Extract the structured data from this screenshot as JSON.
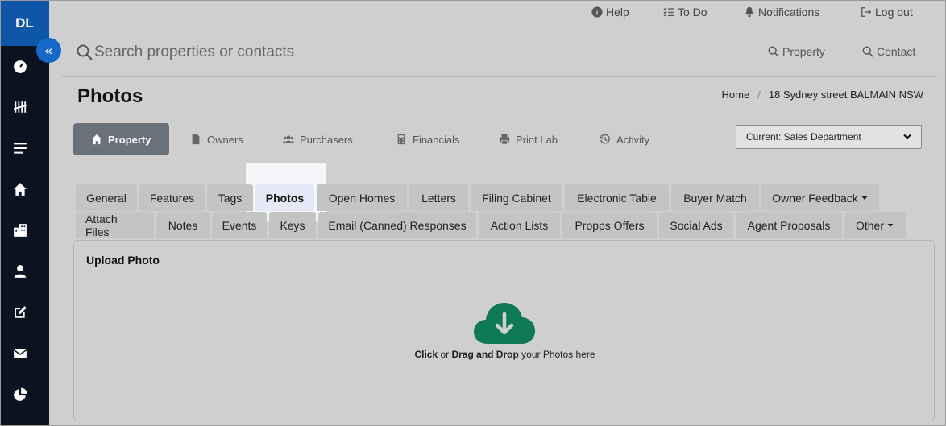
{
  "sidebar": {
    "logo": "DL",
    "collapse_icon": "double-chevron-left-icon",
    "items": [
      {
        "icon": "dashboard-icon"
      },
      {
        "icon": "tally-icon"
      },
      {
        "icon": "list-icon"
      },
      {
        "icon": "home-icon"
      },
      {
        "icon": "building-icon"
      },
      {
        "icon": "user-icon"
      },
      {
        "icon": "edit-icon"
      },
      {
        "icon": "mail-icon"
      },
      {
        "icon": "pie-chart-icon"
      }
    ]
  },
  "topbar": {
    "help": "Help",
    "todo": "To Do",
    "notifications": "Notifications",
    "logout": "Log out"
  },
  "search": {
    "placeholder": "Search properties or contacts",
    "property_label": "Property",
    "contact_label": "Contact"
  },
  "page": {
    "title": "Photos",
    "breadcrumb": [
      "Home",
      "18 Sydney street BALMAIN NSW"
    ]
  },
  "module_tabs": [
    "Property",
    "Owners",
    "Purchasers",
    "Financials",
    "Print Lab",
    "Activity"
  ],
  "department": "Current: Sales Department",
  "subtabs_row1": [
    "General",
    "Features",
    "Tags",
    "Photos",
    "Open Homes",
    "Letters",
    "Filing Cabinet",
    "Electronic Table",
    "Buyer Match",
    "Owner Feedback"
  ],
  "subtabs_row2": [
    "Attach Files",
    "Notes",
    "Events",
    "Keys",
    "Email (Canned) Responses",
    "Action Lists",
    "Propps Offers",
    "Social Ads",
    "Agent Proposals",
    "Other"
  ],
  "upload": {
    "heading": "Upload Photo",
    "click": "Click",
    "or": " or ",
    "drag": "Drag and Drop",
    "rest": " your Photos here"
  },
  "colors": {
    "sidebar_bg": "#0b1220",
    "logo_bg": "#0e56a8",
    "cloud": "#0d7a55",
    "active_tab": "#6b717b"
  }
}
